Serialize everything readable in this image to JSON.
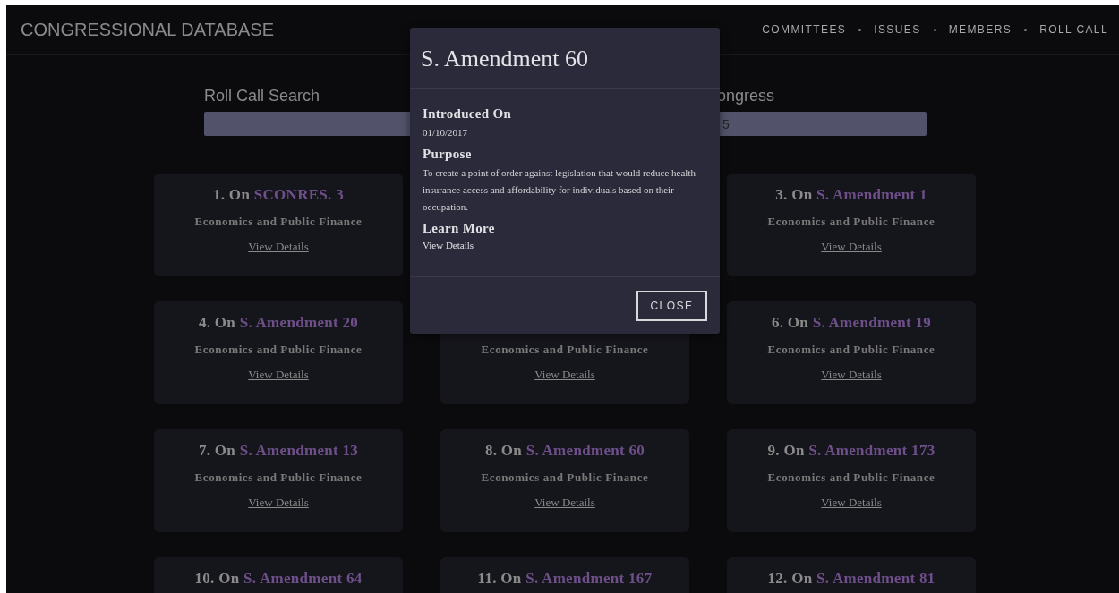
{
  "header": {
    "title": "CONGRESSIONAL DATABASE",
    "nav": [
      {
        "label": "COMMITTEES"
      },
      {
        "label": "ISSUES"
      },
      {
        "label": "MEMBERS"
      },
      {
        "label": "ROLL CALL"
      }
    ]
  },
  "search": {
    "label": "Roll Call Search",
    "label_2": "ongress",
    "value": "5"
  },
  "card_rows": [
    {
      "cards": [
        {
          "prefix": "1. On",
          "bill": "SCONRES. 3",
          "category": "Economics and Public Finance",
          "link": "View Details"
        },
        {
          "prefix": "3. On",
          "bill": "S. Amendment 1",
          "category": "Economics and Public Finance",
          "link": "View Details"
        }
      ]
    },
    {
      "cards": [
        {
          "prefix": "4. On",
          "bill": "S. Amendment 20",
          "category": "Economics and Public Finance",
          "link": "View Details"
        },
        {
          "category": "Economics and Public Finance",
          "link": "View Details"
        },
        {
          "prefix": "6. On",
          "bill": "S. Amendment 19",
          "category": "Economics and Public Finance",
          "link": "View Details"
        }
      ]
    },
    {
      "cards": [
        {
          "prefix": "7. On",
          "bill": "S. Amendment 13",
          "category": "Economics and Public Finance",
          "link": "View Details"
        },
        {
          "prefix": "8. On",
          "bill": "S. Amendment 60",
          "category": "Economics and Public Finance",
          "link": "View Details"
        },
        {
          "prefix": "9. On",
          "bill": "S. Amendment 173",
          "category": "Economics and Public Finance",
          "link": "View Details"
        }
      ]
    },
    {
      "cards": [
        {
          "prefix": "10. On",
          "bill": "S. Amendment 64"
        },
        {
          "prefix": "11. On",
          "bill": "S. Amendment 167"
        },
        {
          "prefix": "12. On",
          "bill": "S. Amendment 81"
        }
      ]
    }
  ],
  "modal": {
    "title": "S. Amendment 60",
    "sections": [
      {
        "heading": "Introduced On",
        "text": "01/10/2017",
        "kind": "text"
      },
      {
        "heading": "Purpose",
        "text": "To create a point of order against legislation that would reduce health insurance access and affordability for individuals based on their occupation.",
        "kind": "text"
      },
      {
        "heading": "Learn More",
        "text": "View Details",
        "kind": "link"
      }
    ],
    "button": "CLOSE"
  }
}
